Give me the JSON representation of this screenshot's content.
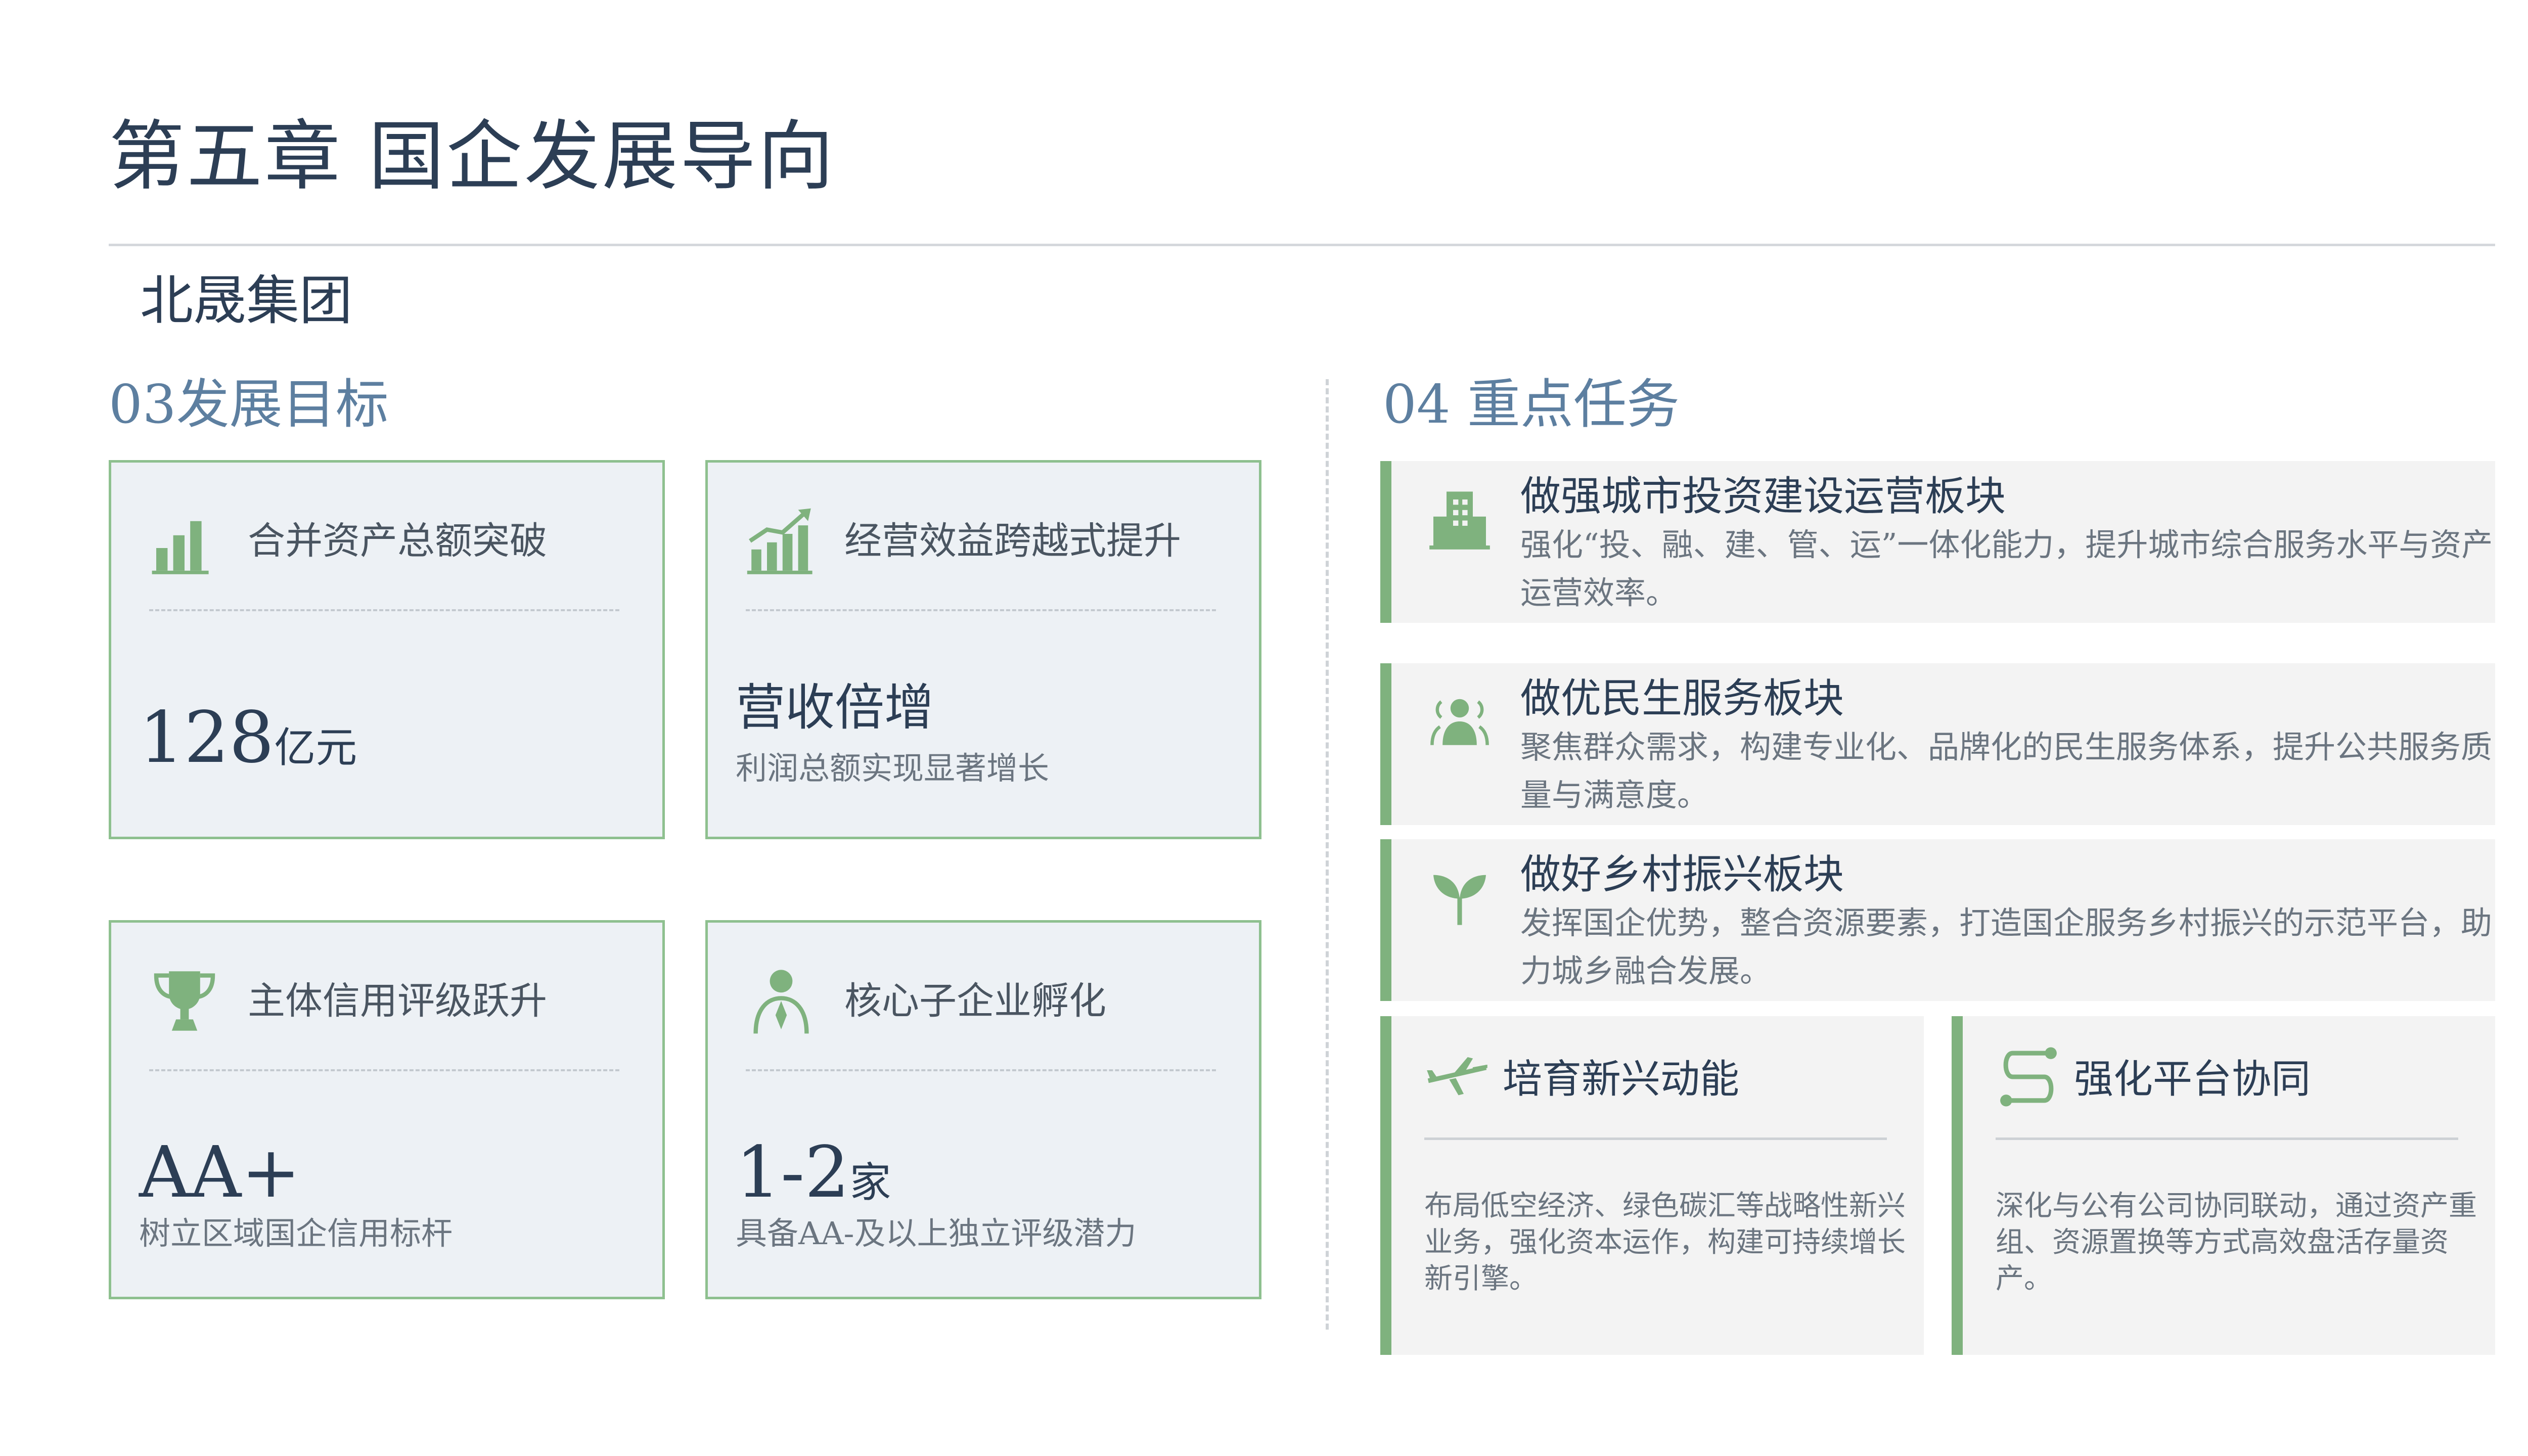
{
  "header": {
    "title": "第五章  国企发展导向",
    "company": "北晟集团"
  },
  "colors": {
    "accent_green": "#7fb27e",
    "title_navy": "#2c3e55",
    "section_blue": "#5d7fa0",
    "card_bg": "#edf1f5"
  },
  "goals": {
    "heading": "03发展目标",
    "items": [
      {
        "icon": "bar-chart-icon",
        "title": "合并资产总额突破",
        "value": "128",
        "unit": "亿元",
        "sub": ""
      },
      {
        "icon": "growth-chart-icon",
        "title": "经营效益跨越式提升",
        "value": "营收倍增",
        "unit": "",
        "sub": "利润总额实现显著增长"
      },
      {
        "icon": "trophy-icon",
        "title": "主体信用评级跃升",
        "value": "AA+",
        "unit": "",
        "sub": "树立区域国企信用标杆"
      },
      {
        "icon": "person-icon",
        "title": "核心子企业孵化",
        "value": "1-2",
        "unit": "家",
        "sub": "具备AA-及以上独立评级潜力"
      }
    ]
  },
  "tasks": {
    "heading": "04  重点任务",
    "items": [
      {
        "icon": "building-icon",
        "title": "做强城市投资建设运营板块",
        "desc": "强化“投、融、建、管、运”一体化能力，提升城市综合服务水平与资产运营效率。"
      },
      {
        "icon": "people-icon",
        "title": "做优民生服务板块",
        "desc": "聚焦群众需求，构建专业化、品牌化的民生服务体系，提升公共服务质量与满意度。"
      },
      {
        "icon": "sprout-icon",
        "title": "做好乡村振兴板块",
        "desc": "发挥国企优势，整合资源要素，打造国企服务乡村振兴的示范平台，助力城乡融合发展。"
      }
    ],
    "small": [
      {
        "icon": "airplane-icon",
        "title": "培育新兴动能",
        "desc": "布局低空经济、绿色碳汇等战略性新兴业务，强化资本运作，构建可持续增长新引擎。"
      },
      {
        "icon": "route-icon",
        "title": "强化平台协同",
        "desc": "深化与公有公司协同联动，通过资产重组、资源置换等方式高效盘活存量资产。"
      }
    ]
  }
}
